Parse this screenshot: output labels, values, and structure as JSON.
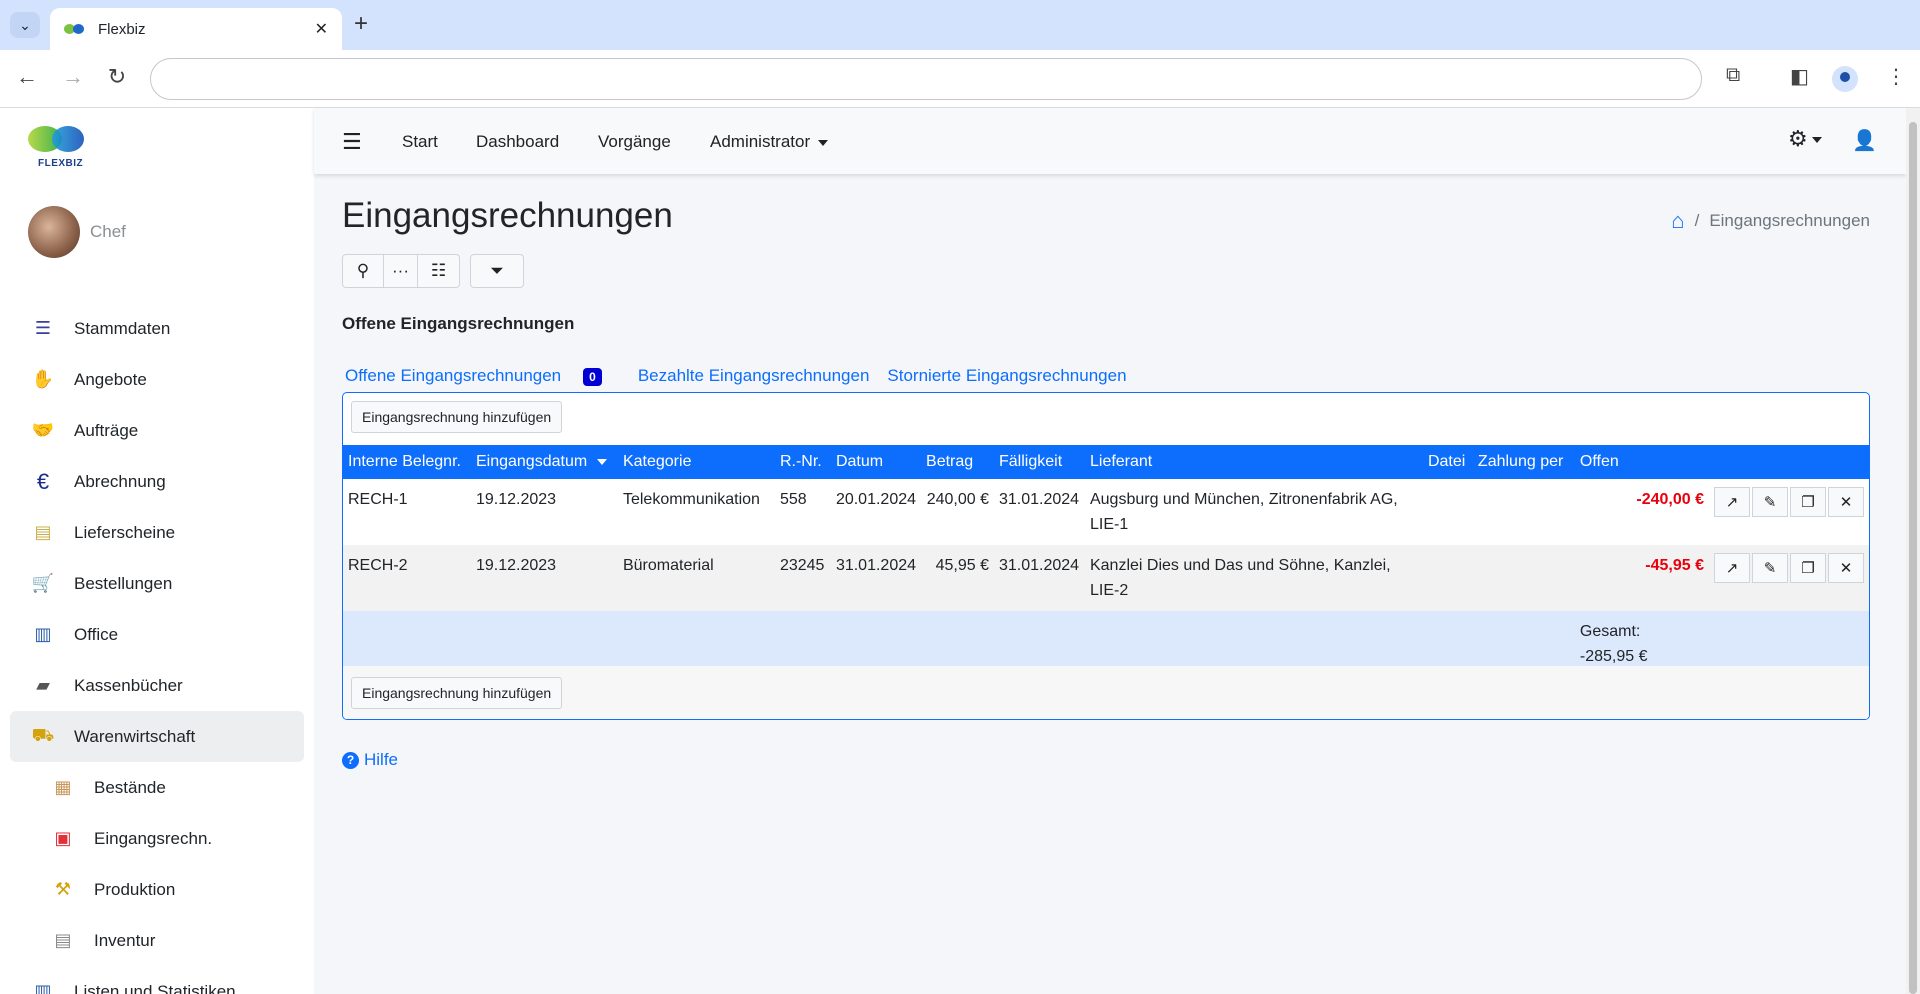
{
  "browser": {
    "tab_title": "Flexbiz",
    "address": "",
    "close": "✕",
    "newtab": "+"
  },
  "sidebar": {
    "logo_text": "FLEXBIZ",
    "user_name": "Chef",
    "items": [
      {
        "label": "Stammdaten",
        "icon": "list-icon"
      },
      {
        "label": "Angebote",
        "icon": "offer-icon"
      },
      {
        "label": "Aufträge",
        "icon": "handshake-icon"
      },
      {
        "label": "Abrechnung",
        "icon": "euro-icon"
      },
      {
        "label": "Lieferscheine",
        "icon": "truck-icon"
      },
      {
        "label": "Bestellungen",
        "icon": "cart-icon"
      },
      {
        "label": "Office",
        "icon": "binder-icon"
      },
      {
        "label": "Kassenbücher",
        "icon": "cashbox-icon"
      },
      {
        "label": "Warenwirtschaft",
        "icon": "forklift-icon"
      },
      {
        "label": "Bestände",
        "icon": "box-icon"
      },
      {
        "label": "Eingangsrechn.",
        "icon": "bag-icon"
      },
      {
        "label": "Produktion",
        "icon": "crane-icon"
      },
      {
        "label": "Inventur",
        "icon": "shelf-icon"
      },
      {
        "label": "Listen und Statistiken",
        "icon": "stats-icon"
      }
    ]
  },
  "navbar": {
    "links": [
      "Start",
      "Dashboard",
      "Vorgänge",
      "Administrator"
    ]
  },
  "page": {
    "title": "Eingangsrechnungen",
    "breadcrumb": "Eingangsrechnungen",
    "breadcrumb_sep": "/",
    "section_title": "Offene Eingangsrechnungen",
    "tabs": [
      "Offene Eingangsrechnungen",
      "Bezahlte Eingangsrechnungen",
      "Stornierte Eingangsrechnungen"
    ],
    "tab_badge": "0",
    "add_button": "Eingangsrechnung hinzufügen",
    "help": "Hilfe",
    "help_icon": "?"
  },
  "table": {
    "headers": [
      "Interne Belegnr.",
      "Eingangsdatum",
      "Kategorie",
      "R.-Nr.",
      "Datum",
      "Betrag",
      "Fälligkeit",
      "Lieferant",
      "Datei",
      "Zahlung per",
      "Offen"
    ],
    "rows": [
      {
        "beleg": "RECH-1",
        "eingang": "19.12.2023",
        "kategorie": "Telekommunikation",
        "rnr": "558",
        "datum": "20.01.2024",
        "betrag": "240,00 €",
        "faellig": "31.01.2024",
        "lieferant": "Augsburg und München, Zitronenfabrik AG, LIE-1",
        "datei": "",
        "zahlung": "",
        "offen": "-240,00 €"
      },
      {
        "beleg": "RECH-2",
        "eingang": "19.12.2023",
        "kategorie": "Büromaterial",
        "rnr": "23245",
        "datum": "31.01.2024",
        "betrag": "45,95 €",
        "faellig": "31.01.2024",
        "lieferant": "Kanzlei Dies und Das und Söhne, Kanzlei, LIE-2",
        "datei": "",
        "zahlung": "",
        "offen": "-45,95 €"
      }
    ],
    "total_label": "Gesamt:",
    "total_value": "-285,95 €"
  },
  "colors": {
    "primary": "#0d6efd",
    "negative": "#e8000d",
    "badge": "#0000d4"
  }
}
